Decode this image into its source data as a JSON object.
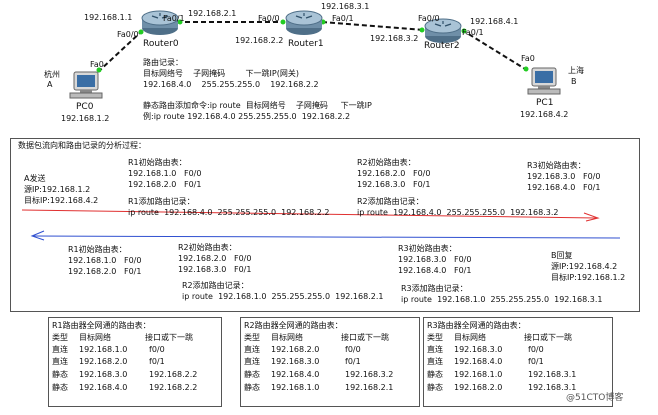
{
  "topology": {
    "router0": {
      "name": "Router0",
      "fa00": "Fa0/0",
      "fa01": "Fa0/1",
      "ip_left": "192.168.1.1",
      "ip_right": "192.168.2.1"
    },
    "router1": {
      "name": "Router1",
      "fa00": "Fa0/0",
      "fa01": "Fa0/1",
      "ip_left": "192.168.2.2",
      "ip_right": "192.168.3.1"
    },
    "router2": {
      "name": "Router2",
      "fa00": "Fa0/0",
      "fa01": "Fa0/1",
      "ip_left": "192.168.3.2",
      "ip_right": "192.168.4.1"
    },
    "pc0": {
      "name": "PC0",
      "port": "Fa0",
      "ip": "192.168.1.2",
      "city": "杭州",
      "tag": "A"
    },
    "pc1": {
      "name": "PC1",
      "port": "Fa0",
      "ip": "192.168.4.2",
      "city": "上海",
      "tag": "B"
    }
  },
  "route_note": {
    "title": "路由记录：",
    "header": "目标网络号    子网掩码        下一跳IP(网关)",
    "row": "192.168.4.0    255.255.255.0    192.168.2.2",
    "cmd_header": "静态路由添加命令:ip route  目标网络号    子网掩码     下一跳IP",
    "cmd_example": "例:ip route 192.168.4.0 255.255.255.0  192.168.2.2"
  },
  "analysis": {
    "title": "数据包流向和路由记录的分析过程：",
    "a_send": [
      "A发送",
      "源IP:192.168.1.2",
      "目标IP:192.168.4.2"
    ],
    "r1_init": [
      "R1初始路由表：",
      "192.168.1.0   F0/0",
      "192.168.2.0   F0/1"
    ],
    "r1_add": [
      "R1添加路由记录：",
      "ip route  192.168.4.0  255.255.255.0  192.168.2.2"
    ],
    "r2_init": [
      "R2初始路由表：",
      "192.168.2.0   F0/0",
      "192.168.3.0   F0/1"
    ],
    "r2_add": [
      "R2添加路由记录：",
      "ip route  192.168.4.0  255.255.255.0  192.168.3.2"
    ],
    "r3_init": [
      "R3初始路由表：",
      "192.168.3.0   F0/0",
      "192.168.4.0   F0/1"
    ],
    "b_reply": [
      "B回复",
      "源IP:192.168.4.2",
      "目标IP:192.168.1.2"
    ],
    "r1_init_b": [
      "R1初始路由表：",
      "192.168.1.0   F0/0",
      "192.168.2.0   F0/1"
    ],
    "r2_init_b": [
      "R2初始路由表：",
      "192.168.2.0   F0/0",
      "192.168.3.0   F0/1"
    ],
    "r2_add_b": [
      "R2添加路由记录：",
      "ip route  192.168.1.0  255.255.255.0  192.168.2.1"
    ],
    "r3_init_b": [
      "R3初始路由表：",
      "192.168.3.0   F0/0",
      "192.168.4.0   F0/1"
    ],
    "r3_add_b": [
      "R3添加路由记录：",
      "ip route  192.168.1.0  255.255.255.0  192.168.3.1"
    ]
  },
  "full_tables": [
    {
      "title": "R1路由器全网通的路由表：",
      "head": [
        "类型",
        "目标网络",
        "接口或下一跳"
      ],
      "rows": [
        [
          "直连",
          "192.168.1.0",
          "f0/0"
        ],
        [
          "直连",
          "192.168.2.0",
          "f0/1"
        ],
        [
          "静态",
          "192.168.3.0",
          "192.168.2.2"
        ],
        [
          "静态",
          "192.168.4.0",
          "192.168.2.2"
        ]
      ]
    },
    {
      "title": "R2路由器全网通的路由表：",
      "head": [
        "类型",
        "目标网络",
        "接口或下一跳"
      ],
      "rows": [
        [
          "直连",
          "192.168.2.0",
          "f0/0"
        ],
        [
          "直连",
          "192.168.3.0",
          "f0/1"
        ],
        [
          "静态",
          "192.168.4.0",
          "192.168.3.2"
        ],
        [
          "静态",
          "192.168.1.0",
          "192.168.2.1"
        ]
      ]
    },
    {
      "title": "R3路由器全网通的路由表：",
      "head": [
        "类型",
        "目标网络",
        "接口或下一跳"
      ],
      "rows": [
        [
          "直连",
          "192.168.3.0",
          "f0/0"
        ],
        [
          "直连",
          "192.168.4.0",
          "f0/1"
        ],
        [
          "静态",
          "192.168.1.0",
          "192.168.3.1"
        ],
        [
          "静态",
          "192.168.2.0",
          "192.168.3.1"
        ]
      ]
    }
  ],
  "watermark": "@51CTO博客",
  "colors": {
    "link": "#111111",
    "port_dot": "#22cc22",
    "arrow_red": "#e03030",
    "arrow_blue": "#3050d0",
    "router": "#6f8fa8"
  }
}
